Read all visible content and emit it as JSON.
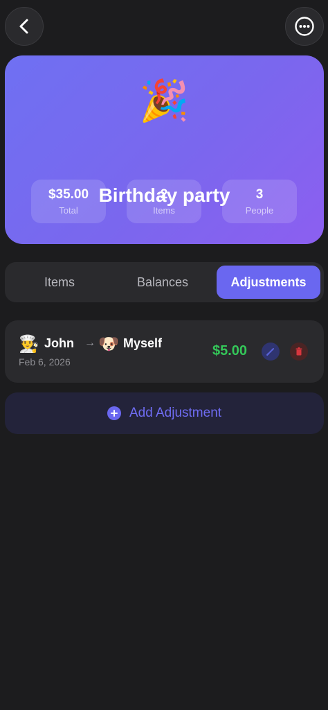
{
  "header": {
    "back_icon": "chevron-left-icon",
    "more_icon": "ellipsis-circle-icon"
  },
  "event": {
    "emoji": "🎉",
    "title": "Birthday party",
    "stats": [
      {
        "value": "$35.00",
        "label": "Total"
      },
      {
        "value": "2",
        "label": "Items"
      },
      {
        "value": "3",
        "label": "People"
      }
    ]
  },
  "tabs": [
    {
      "label": "Items",
      "active": false
    },
    {
      "label": "Balances",
      "active": false
    },
    {
      "label": "Adjustments",
      "active": true
    }
  ],
  "adjustments": [
    {
      "from_avatar": "👨‍🍳",
      "from_name": "John",
      "arrow": "→",
      "to_avatar": "🐶",
      "to_name": "Myself",
      "date": "Feb 6, 2026",
      "amount": "$5.00"
    }
  ],
  "add_button": {
    "label": "Add Adjustment"
  },
  "colors": {
    "accent": "#6a67f0",
    "amount_positive": "#34c759",
    "delete": "#d9363e",
    "background": "#1c1c1e",
    "card": "#2a2a2d"
  }
}
